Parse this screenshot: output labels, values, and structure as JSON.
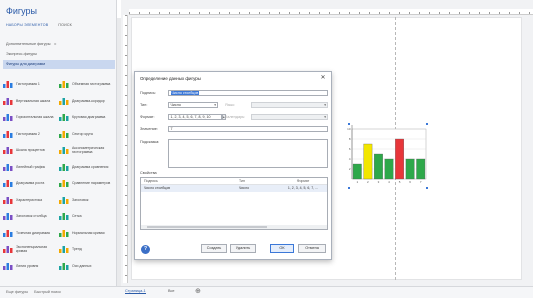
{
  "pane": {
    "title": "Фигуры",
    "nav_more": "НАБОРЫ ЭЛЕМЕНТОВ",
    "nav_search": "ПОИСК",
    "stencils": [
      {
        "label": "Дополнительные фигуры",
        "pin": "▸"
      },
      {
        "label": "Экспресс-фигуры",
        "pin": ""
      },
      {
        "label": "Фигуры для диаграмм",
        "pin": ""
      }
    ],
    "shapes": [
      {
        "label": "Гистограмма 1",
        "icon": "bar-chart-icon"
      },
      {
        "label": "Объемная гистограмма",
        "icon": "3d-bar-chart-icon"
      },
      {
        "label": "Вертикальная шкала",
        "icon": "vertical-scale-icon"
      },
      {
        "label": "Диаграмма-коридор",
        "icon": "corridor-chart-icon"
      },
      {
        "label": "Горизонтальная шкала",
        "icon": "horizontal-scale-icon"
      },
      {
        "label": "Круговая диаграмма",
        "icon": "pie-chart-icon"
      },
      {
        "label": "Гистограмма 2",
        "icon": "bar-chart-2-icon"
      },
      {
        "label": "Сектор круга",
        "icon": "pie-sector-icon"
      },
      {
        "label": "Шкала процентов",
        "icon": "percent-scale-icon"
      },
      {
        "label": "Аксонометрическая гистограмма",
        "icon": "axonometric-icon"
      },
      {
        "label": "Линейный график",
        "icon": "line-chart-icon"
      },
      {
        "label": "Диаграмма сравнения",
        "icon": "comparison-chart-icon"
      },
      {
        "label": "Диаграмма роста",
        "icon": "growth-chart-icon"
      },
      {
        "label": "Сравнение параметров",
        "icon": "parameter-compare-icon"
      },
      {
        "label": "Характеристика",
        "icon": "feature-icon"
      },
      {
        "label": "Заголовок",
        "icon": "heading-icon"
      },
      {
        "label": "Заголовок столбца",
        "icon": "column-heading-icon"
      },
      {
        "label": "Сетка",
        "icon": "grid-icon"
      },
      {
        "label": "Точечная диаграмма",
        "icon": "scatter-icon"
      },
      {
        "label": "Нормальная кривая",
        "icon": "normal-curve-icon"
      },
      {
        "label": "Экспоненциальная кривая",
        "icon": "exponential-curve-icon"
      },
      {
        "label": "Тренд",
        "icon": "trend-icon"
      },
      {
        "label": "Линия уровня",
        "icon": "level-line-icon"
      },
      {
        "label": "Оси данных",
        "icon": "data-axes-icon"
      }
    ],
    "footer_more": "Еще фигуры",
    "footer_quick": "Быстрый поиск"
  },
  "dialog": {
    "title": "Определение данных фигуры",
    "label_label": "Подпись:",
    "label_value": "Число столбцов",
    "type_label": "Тип:",
    "type_value": "Число",
    "language_label": "Язык:",
    "format_label": "Формат:",
    "format_value": "1, 2, 3, 4, 5, 6, 7, 8, 9, 10",
    "calendar_label": "Календарь:",
    "value_label": "Значение:",
    "value_value": "7",
    "prompt_label": "Подсказка:",
    "props_section": "Свойства",
    "props_headers": [
      "Подпись",
      "Тип",
      "Формат"
    ],
    "props_rows": [
      {
        "label": "Число столбцов",
        "type": "Число",
        "format": "1, 2, 3, 4, 5, 6, 7, ..."
      }
    ],
    "help": "?",
    "btn_new": "Создать",
    "btn_delete": "Удалить",
    "btn_ok": "ОК",
    "btn_cancel": "Отмена"
  },
  "canvas": {
    "page_tab": "Страница-1",
    "all_tab": "Все",
    "add_tab": "⊕"
  },
  "chart_data": {
    "type": "bar",
    "categories": [
      "1",
      "2",
      "3",
      "4",
      "5",
      "6",
      "7"
    ],
    "values": [
      3,
      7,
      5,
      4,
      8,
      4,
      4
    ],
    "colors": [
      "#2ea84a",
      "#f2e600",
      "#2ea84a",
      "#2ea84a",
      "#e8363a",
      "#2ea84a",
      "#2ea84a"
    ],
    "ylim": [
      0,
      10
    ],
    "y_ticks": [
      "2",
      "4",
      "6",
      "8",
      "10"
    ],
    "title": "",
    "xlabel": "",
    "ylabel": "",
    "grid": true
  }
}
